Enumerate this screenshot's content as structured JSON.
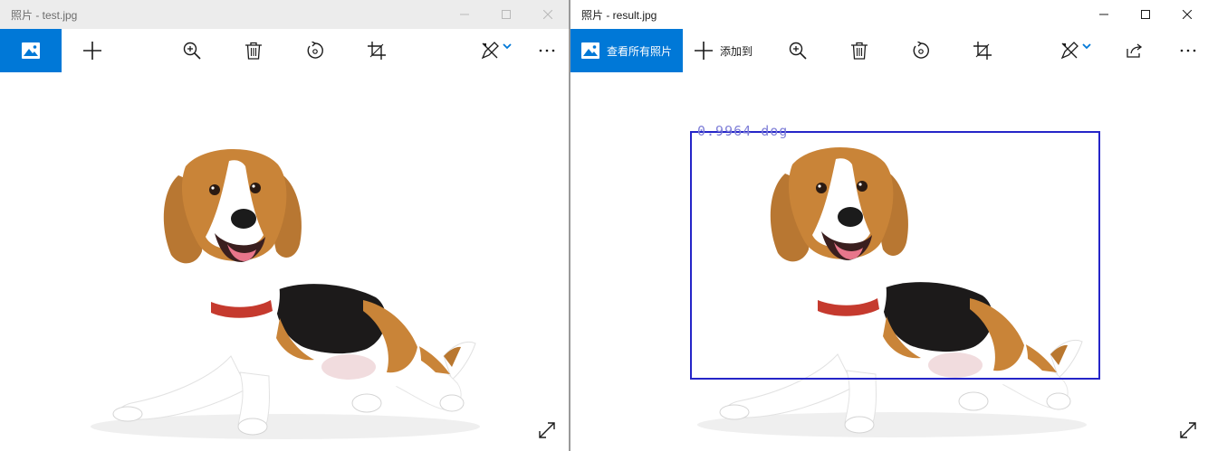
{
  "left_window": {
    "title": "照片 - test.jpg",
    "toolbar": {
      "view_all_icon": "photos-gallery-icon",
      "add_icon": "plus-icon",
      "zoom_icon": "zoom-in-icon",
      "delete_icon": "trash-icon",
      "rotate_icon": "rotate-icon",
      "crop_icon": "crop-icon",
      "edit_icon": "edit-create-icon",
      "more_icon": "more-icon"
    },
    "photo": {
      "subject": "beagle-dog-photo"
    }
  },
  "right_window": {
    "title": "照片 - result.jpg",
    "toolbar": {
      "view_all_label": "查看所有照片",
      "add_label": "添加到",
      "view_all_icon": "photos-gallery-icon",
      "add_icon": "plus-icon",
      "zoom_icon": "zoom-in-icon",
      "delete_icon": "trash-icon",
      "rotate_icon": "rotate-icon",
      "crop_icon": "crop-icon",
      "edit_icon": "edit-create-icon",
      "share_icon": "share-icon",
      "more_icon": "more-icon"
    },
    "detection": {
      "label": "0.9964  dog",
      "score": 0.9964,
      "class": "dog",
      "box_color": "#2525c8"
    }
  },
  "colors": {
    "accent": "#0078d7",
    "inactive_titlebar": "#ececec"
  }
}
